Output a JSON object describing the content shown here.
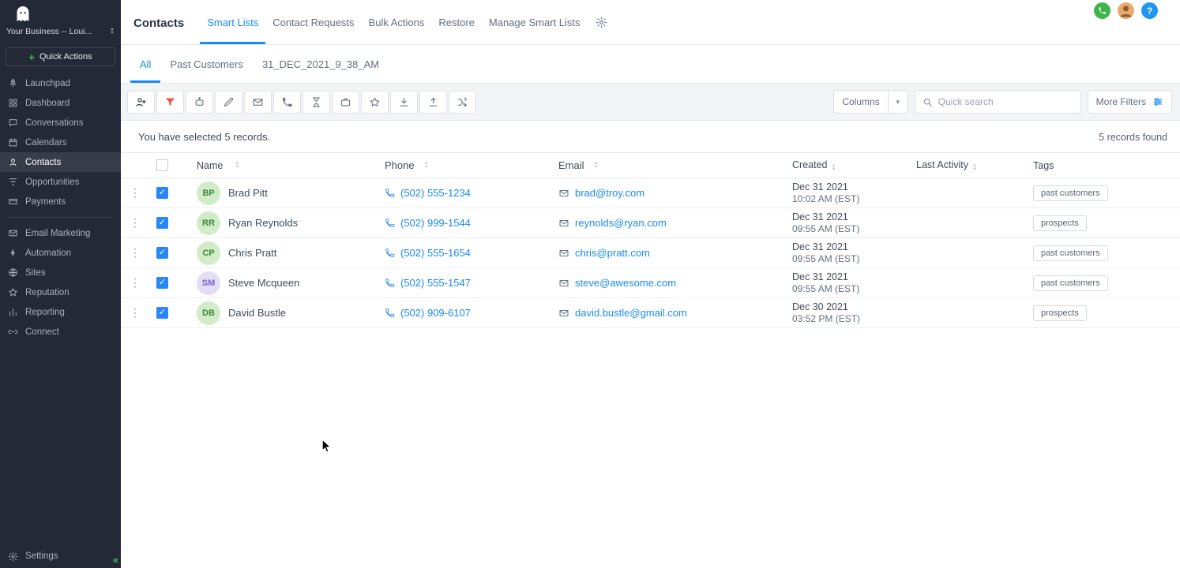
{
  "colors": {
    "accent_blue": "#188bf6",
    "sidebar_bg": "#232936",
    "filter_red": "#f25244",
    "green": "#3db54a",
    "checkbox_blue": "#2787f5"
  },
  "sidebar": {
    "business_name": "Your Business -- Loui...",
    "quick_actions_label": "Quick Actions",
    "items": [
      "Launchpad",
      "Dashboard",
      "Conversations",
      "Calendars",
      "Contacts",
      "Opportunities",
      "Payments",
      "Email Marketing",
      "Automation",
      "Sites",
      "Reputation",
      "Reporting",
      "Connect"
    ],
    "active_item": "Contacts",
    "settings_label": "Settings",
    "icons": [
      "logo-icon",
      "rocket-icon",
      "dashboard-icon",
      "chat-icon",
      "calendar-icon",
      "person-icon",
      "funnel-lines-icon",
      "card-icon",
      "envelope-icon",
      "bolt-icon",
      "globe-icon",
      "star-icon",
      "bar-chart-icon",
      "link-icon",
      "gear-icon",
      "collapse-chevrons-icon"
    ]
  },
  "header": {
    "title": "Contacts",
    "tabs": [
      "Smart Lists",
      "Contact Requests",
      "Bulk Actions",
      "Restore",
      "Manage Smart Lists"
    ],
    "active_tab": "Smart Lists",
    "icons": [
      "smart-lists-gear-icon",
      "phone-icon",
      "user-avatar",
      "help-icon"
    ]
  },
  "list_tabs": {
    "tabs": [
      "All",
      "Past Customers",
      "31_DEC_2021_9_38_AM"
    ],
    "active": "All"
  },
  "toolbar": {
    "icons": [
      "add-contact-icon",
      "quick-filter-icon",
      "robot-icon",
      "pencil-icon",
      "send-email-icon",
      "call-icon",
      "hourglass-icon",
      "briefcase-icon",
      "star-icon",
      "import-icon",
      "export-icon",
      "merge-icon"
    ],
    "columns_label": "Columns",
    "search_placeholder": "Quick search",
    "search_value": "",
    "more_filters_label": "More Filters"
  },
  "status": {
    "selection_text": "You have selected 5 records.",
    "records_found_text": "5 records found"
  },
  "table": {
    "headers": {
      "name": "Name",
      "phone": "Phone",
      "email": "Email",
      "created": "Created",
      "last_activity": "Last Activity",
      "tags": "Tags"
    },
    "rows": [
      {
        "initials": "BP",
        "name": "Brad Pitt",
        "phone": "(502) 555-1234",
        "email": "brad@troy.com",
        "created_date": "Dec 31 2021",
        "created_time": "10:02 AM (EST)",
        "last_activity": "",
        "tag": "past customers",
        "avatar_bg": "#d2ecca",
        "avatar_color": "#3d8b37"
      },
      {
        "initials": "RR",
        "name": "Ryan Reynolds",
        "phone": "(502) 999-1544",
        "email": "reynolds@ryan.com",
        "created_date": "Dec 31 2021",
        "created_time": "09:55 AM (EST)",
        "last_activity": "",
        "tag": "prospects",
        "avatar_bg": "#d2ecca",
        "avatar_color": "#3d8b37"
      },
      {
        "initials": "CP",
        "name": "Chris Pratt",
        "phone": "(502) 555-1654",
        "email": "chris@pratt.com",
        "created_date": "Dec 31 2021",
        "created_time": "09:55 AM (EST)",
        "last_activity": "",
        "tag": "past customers",
        "avatar_bg": "#d2ecca",
        "avatar_color": "#3d8b37"
      },
      {
        "initials": "SM",
        "name": "Steve Mcqueen",
        "phone": "(502) 555-1547",
        "email": "steve@awesome.com",
        "created_date": "Dec 31 2021",
        "created_time": "09:55 AM (EST)",
        "last_activity": "",
        "tag": "past customers",
        "avatar_bg": "#e4ddf6",
        "avatar_color": "#7a5fd0"
      },
      {
        "initials": "DB",
        "name": "David Bustle",
        "phone": "(502) 909-6107",
        "email": "david.bustle@gmail.com",
        "created_date": "Dec 30 2021",
        "created_time": "03:52 PM (EST)",
        "last_activity": "",
        "tag": "prospects",
        "avatar_bg": "#d2ecca",
        "avatar_color": "#3d8b37"
      }
    ]
  }
}
